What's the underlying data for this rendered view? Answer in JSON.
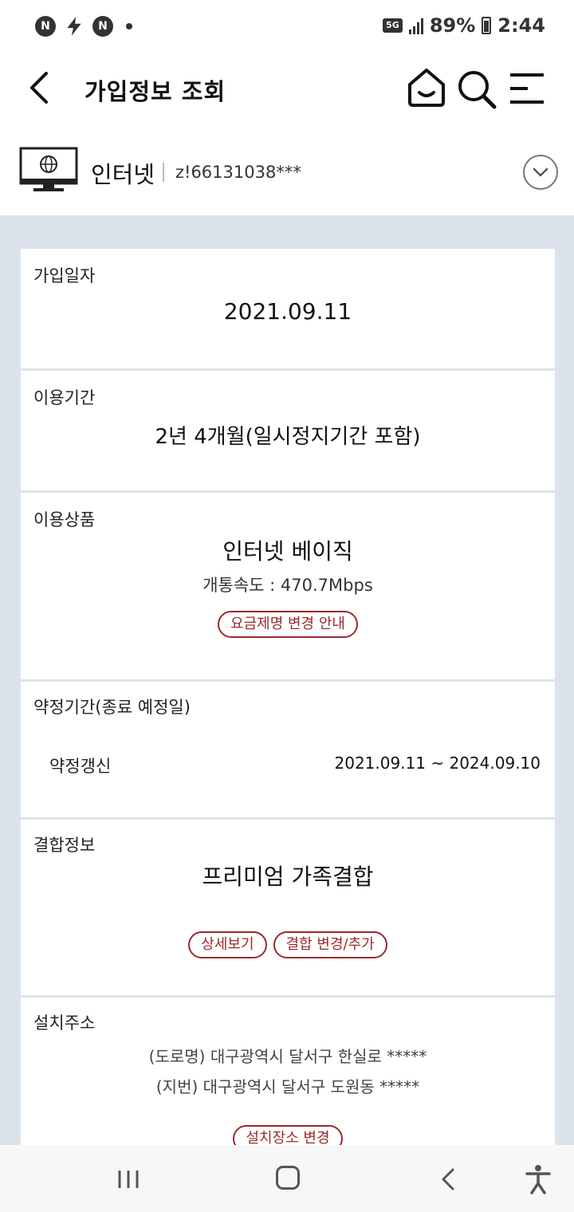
{
  "status_bar": {
    "left_icons": [
      "n-icon",
      "bolt-icon",
      "n-icon",
      "dot-icon"
    ],
    "network": "5G",
    "battery": "89%",
    "time": "2:44"
  },
  "header": {
    "title": "가입정보 조회"
  },
  "service": {
    "name": "인터넷",
    "id": "z!66131038***"
  },
  "cards": {
    "join_date": {
      "label": "가입일자",
      "value": "2021.09.11"
    },
    "usage_period": {
      "label": "이용기간",
      "value": "2년 4개월(일시정지기간 포함)"
    },
    "product": {
      "label": "이용상품",
      "value": "인터넷 베이직",
      "speed": "개통속도 : 470.7Mbps",
      "button": "요금제명 변경 안내"
    },
    "contract": {
      "label": "약정기간(종료 예정일)",
      "type": "약정갱신",
      "range": "2021.09.11 ~ 2024.09.10"
    },
    "bundle": {
      "label": "결합정보",
      "value": "프리미엄 가족결합",
      "detail_button": "상세보기",
      "change_button": "결합 변경/추가"
    },
    "address": {
      "label": "설치주소",
      "road": "(도로명) 대구광역시 달서구 한실로 *****",
      "lot": "(지번) 대구광역시 달서구 도원동 *****",
      "button": "설치장소 변경"
    }
  },
  "colors": {
    "accent": "#9b2a2a",
    "background": "#dde3ec"
  }
}
